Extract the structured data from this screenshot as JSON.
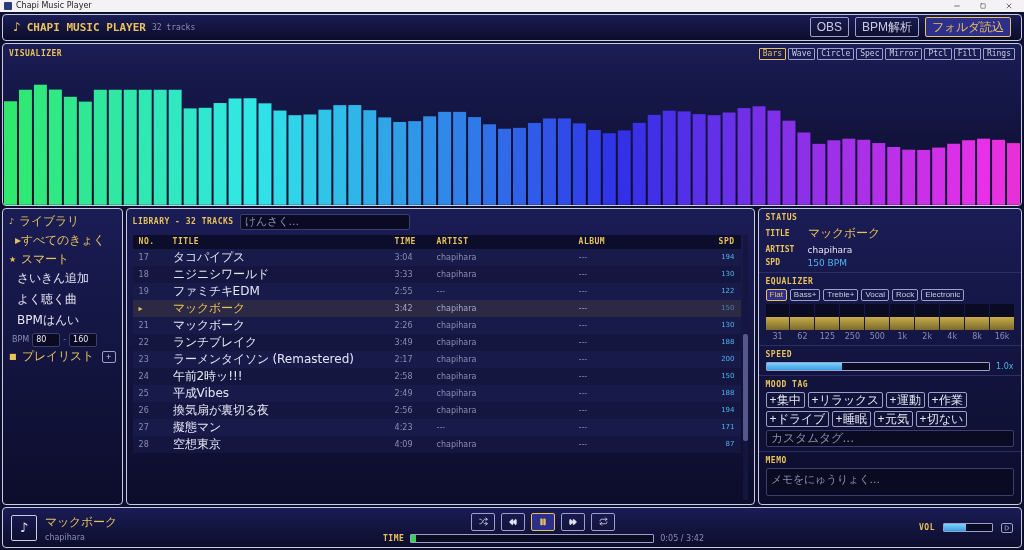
{
  "window": {
    "title": "Chapi Music Player"
  },
  "header": {
    "logo": "♪",
    "title": "CHAPI MUSIC PLAYER",
    "count": "32 tracks",
    "buttons": [
      {
        "label": "OBS",
        "primary": false
      },
      {
        "label": "BPM解析",
        "primary": false
      },
      {
        "label": "フォルダ読込",
        "primary": true
      }
    ]
  },
  "visualizer": {
    "title": "VISUALIZER",
    "modes": [
      {
        "label": "Bars",
        "selected": true
      },
      {
        "label": "Wave",
        "selected": false
      },
      {
        "label": "Circle",
        "selected": false
      },
      {
        "label": "Spec",
        "selected": false
      },
      {
        "label": "Mirror",
        "selected": false
      },
      {
        "label": "Ptcl",
        "selected": false
      },
      {
        "label": "Fill",
        "selected": false
      },
      {
        "label": "Rings",
        "selected": false
      }
    ]
  },
  "sidebar": {
    "items": [
      {
        "kind": "section",
        "icon": "♪",
        "label": "ライブラリ"
      },
      {
        "kind": "item",
        "icon": "▸",
        "label": "すべてのきょく",
        "selected": true
      },
      {
        "kind": "section",
        "icon": "★",
        "label": "スマート"
      },
      {
        "kind": "item",
        "label": "さいきん追加",
        "selected": false
      },
      {
        "kind": "item",
        "label": "よく聴く曲",
        "selected": false
      },
      {
        "kind": "item",
        "label": "BPMはんい",
        "selected": false
      },
      {
        "kind": "range",
        "label": "BPM",
        "min": "80",
        "sep": "-",
        "max": "160"
      },
      {
        "kind": "section",
        "icon": "■",
        "label": "プレイリスト",
        "add": "+"
      }
    ]
  },
  "library": {
    "title": "LIBRARY - 32 TRACKS",
    "search": {
      "placeholder": "けんさく..."
    },
    "columns": [
      "NO.",
      "TITLE",
      "TIME",
      "ARTIST",
      "ALBUM",
      "SPD"
    ],
    "rows": [
      {
        "no": "17",
        "title": "タコパイプス",
        "time": "3:04",
        "artist": "chapihara",
        "album": "---",
        "spd": "194",
        "playing": false
      },
      {
        "no": "18",
        "title": "ニジニシワールド",
        "time": "3:33",
        "artist": "chapihara",
        "album": "---",
        "spd": "130",
        "playing": false
      },
      {
        "no": "19",
        "title": "ファミチキEDM",
        "time": "2:55",
        "artist": "---",
        "album": "---",
        "spd": "122",
        "playing": false
      },
      {
        "no": "▸",
        "title": "マックボーク",
        "time": "3:42",
        "artist": "chapihara",
        "album": "---",
        "spd": "150",
        "playing": true
      },
      {
        "no": "21",
        "title": "マックボーク",
        "time": "2:26",
        "artist": "chapihara",
        "album": "---",
        "spd": "130",
        "playing": false
      },
      {
        "no": "22",
        "title": "ランチブレイク",
        "time": "3:49",
        "artist": "chapihara",
        "album": "---",
        "spd": "188",
        "playing": false
      },
      {
        "no": "23",
        "title": "ラーメンタイソン (Remastered)",
        "time": "2:17",
        "artist": "chapihara",
        "album": "---",
        "spd": "200",
        "playing": false
      },
      {
        "no": "24",
        "title": "午前2時ッ!!!",
        "time": "2:58",
        "artist": "chapihara",
        "album": "---",
        "spd": "150",
        "playing": false
      },
      {
        "no": "25",
        "title": "平成Vibes",
        "time": "2:49",
        "artist": "chapihara",
        "album": "---",
        "spd": "188",
        "playing": false
      },
      {
        "no": "26",
        "title": "換気扇が裏切る夜",
        "time": "2:56",
        "artist": "chapihara",
        "album": "---",
        "spd": "194",
        "playing": false
      },
      {
        "no": "27",
        "title": "擬態マン",
        "time": "4:23",
        "artist": "---",
        "album": "---",
        "spd": "171",
        "playing": false
      },
      {
        "no": "28",
        "title": "空想東京",
        "time": "4:09",
        "artist": "chapihara",
        "album": "---",
        "spd": "87",
        "playing": false
      }
    ]
  },
  "status": {
    "title": "STATUS",
    "fields": [
      {
        "label": "TITLE",
        "value": "マックボーク",
        "kind": "title"
      },
      {
        "label": "ARTIST",
        "value": "chapihara",
        "kind": "text"
      },
      {
        "label": "SPD",
        "value": "150 BPM",
        "kind": "bpm"
      }
    ]
  },
  "equalizer": {
    "title": "EQUALIZER",
    "presets": [
      {
        "label": "Flat",
        "selected": true
      },
      {
        "label": "Bass+",
        "selected": false
      },
      {
        "label": "Treble+",
        "selected": false
      },
      {
        "label": "Vocal",
        "selected": false
      },
      {
        "label": "Rock",
        "selected": false
      },
      {
        "label": "Electronic",
        "selected": false
      }
    ],
    "bands": [
      {
        "label": "31",
        "level": 0.5
      },
      {
        "label": "62",
        "level": 0.5
      },
      {
        "label": "125",
        "level": 0.5
      },
      {
        "label": "250",
        "level": 0.5
      },
      {
        "label": "500",
        "level": 0.5
      },
      {
        "label": "1k",
        "level": 0.5
      },
      {
        "label": "2k",
        "level": 0.5
      },
      {
        "label": "4k",
        "level": 0.5
      },
      {
        "label": "8k",
        "level": 0.5
      },
      {
        "label": "16k",
        "level": 0.5
      }
    ]
  },
  "speed": {
    "title": "SPEED",
    "level": 0.34,
    "reading": "1.0x"
  },
  "mood": {
    "title": "MOOD TAG",
    "tags": [
      "+集中",
      "+リラックス",
      "+運動",
      "+作業",
      "+ドライブ",
      "+睡眠",
      "+元気",
      "+切ない"
    ],
    "placeholder": "カスタムタグ..."
  },
  "memo": {
    "title": "MEMO",
    "placeholder": "メモをにゅうりょく..."
  },
  "player": {
    "icon": "♪",
    "title": "マックボーク",
    "artist": "chapihara",
    "controls": [
      {
        "kind": "shuffle",
        "active": false
      },
      {
        "kind": "prev",
        "active": false
      },
      {
        "kind": "pause",
        "active": true
      },
      {
        "kind": "next",
        "active": false
      },
      {
        "kind": "repeat",
        "active": false
      }
    ],
    "time_label": "TIME",
    "progress": {
      "level": 0.02
    },
    "time": "0:05 / 3:42",
    "volume_label": "VOL",
    "volume": {
      "level": 0.45
    }
  }
}
